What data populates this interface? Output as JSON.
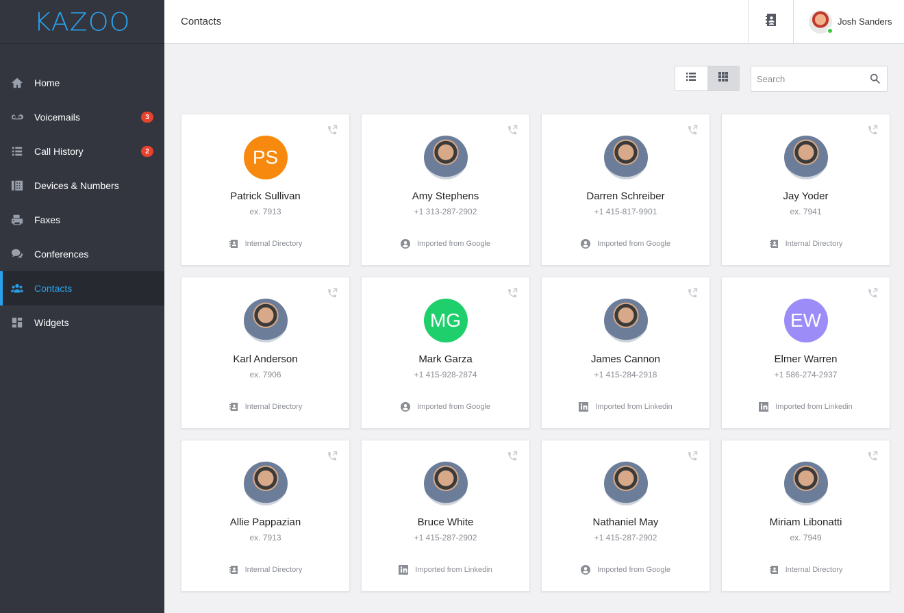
{
  "app": {
    "logo": "KAZOO"
  },
  "header": {
    "title": "Contacts",
    "user_name": "Josh Sanders"
  },
  "sidebar": {
    "items": [
      {
        "label": "Home",
        "icon": "home-icon"
      },
      {
        "label": "Voicemails",
        "icon": "voicemail-icon",
        "badge": "3"
      },
      {
        "label": "Call History",
        "icon": "list-icon",
        "badge": "2"
      },
      {
        "label": "Devices & Numbers",
        "icon": "device-icon"
      },
      {
        "label": "Faxes",
        "icon": "fax-icon"
      },
      {
        "label": "Conferences",
        "icon": "chat-icon"
      },
      {
        "label": "Contacts",
        "icon": "users-icon",
        "active": true
      },
      {
        "label": "Widgets",
        "icon": "widgets-icon"
      }
    ]
  },
  "toolbar": {
    "view_mode": "grid",
    "search_placeholder": "Search"
  },
  "colors": {
    "accent": "#2aa1ec",
    "sidebar": "#33363f",
    "badge": "#e8412d"
  },
  "contacts": [
    {
      "name": "Patrick Sullivan",
      "phone": "ex. 7913",
      "source": "Internal Directory",
      "source_type": "directory",
      "initials": "PS",
      "color": "#f7890e"
    },
    {
      "name": "Amy Stephens",
      "phone": "+1 313-287-2902",
      "source": "Imported from Google",
      "source_type": "google",
      "initials": "",
      "color": ""
    },
    {
      "name": "Darren Schreiber",
      "phone": "+1 415-817-9901",
      "source": "Imported from Google",
      "source_type": "google",
      "initials": "",
      "color": ""
    },
    {
      "name": "Jay Yoder",
      "phone": "ex. 7941",
      "source": "Internal Directory",
      "source_type": "directory",
      "initials": "",
      "color": ""
    },
    {
      "name": "Karl Anderson",
      "phone": "ex. 7906",
      "source": "Internal Directory",
      "source_type": "directory",
      "initials": "",
      "color": ""
    },
    {
      "name": "Mark Garza",
      "phone": "+1 415-928-2874",
      "source": "Imported from Google",
      "source_type": "google",
      "initials": "MG",
      "color": "#1fcf6b"
    },
    {
      "name": "James Cannon",
      "phone": "+1 415-284-2918",
      "source": "Imported from Linkedin",
      "source_type": "linkedin",
      "initials": "",
      "color": ""
    },
    {
      "name": "Elmer Warren",
      "phone": "+1 586-274-2937",
      "source": "Imported from Linkedin",
      "source_type": "linkedin",
      "initials": "EW",
      "color": "#9b8cf7"
    },
    {
      "name": "Allie Pappazian",
      "phone": "ex. 7913",
      "source": "Internal Directory",
      "source_type": "directory",
      "initials": "",
      "color": ""
    },
    {
      "name": "Bruce White",
      "phone": "+1 415-287-2902",
      "source": "Imported from Linkedin",
      "source_type": "linkedin",
      "initials": "",
      "color": ""
    },
    {
      "name": "Nathaniel May",
      "phone": "+1 415-287-2902",
      "source": "Imported from Google",
      "source_type": "google",
      "initials": "",
      "color": ""
    },
    {
      "name": "Miriam Libonatti",
      "phone": "ex. 7949",
      "source": "Internal Directory",
      "source_type": "directory",
      "initials": "",
      "color": ""
    }
  ]
}
